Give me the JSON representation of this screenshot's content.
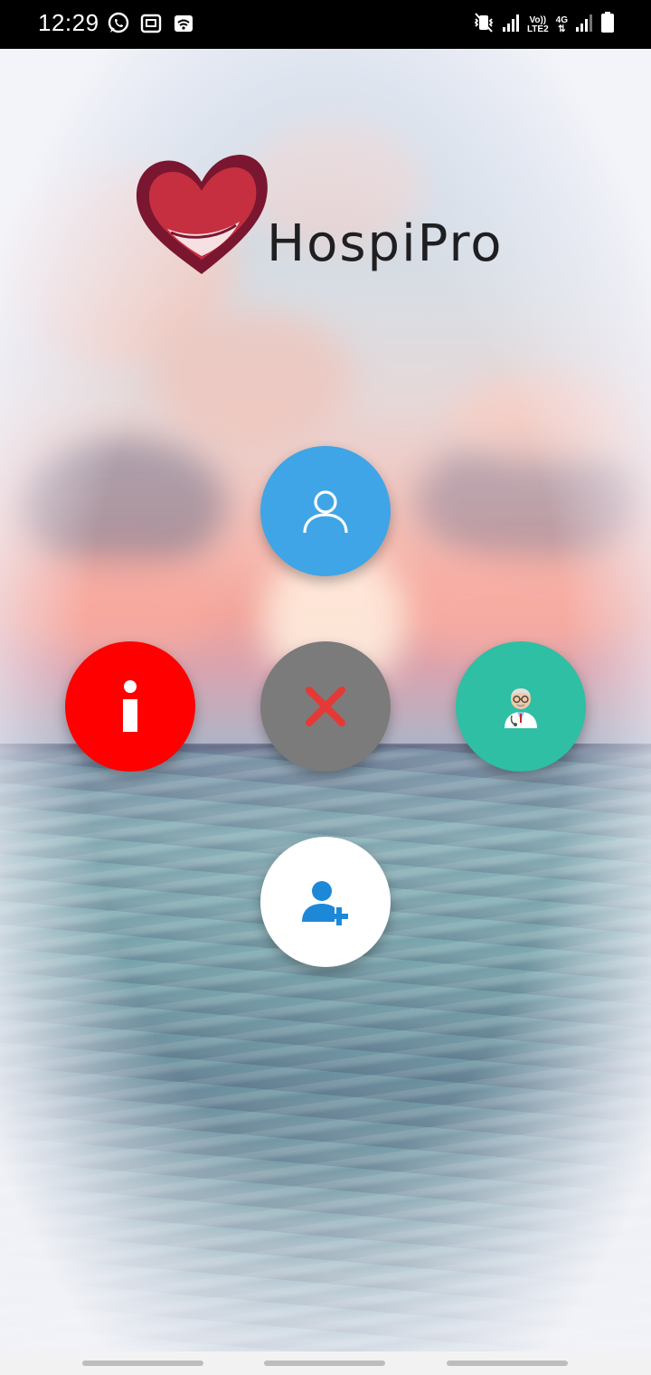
{
  "status_bar": {
    "time": "12:29",
    "left_icons": [
      "whatsapp-icon",
      "app-icon",
      "wifi-calling-icon"
    ],
    "network_top": "Vo))",
    "network_bottom": "LTE2",
    "data_type": "4G"
  },
  "logo": {
    "brand_name": "HospiPro",
    "colors": {
      "heart": "#c62f3f",
      "heart_dark": "#7a1630"
    }
  },
  "fab_menu": {
    "profile": {
      "icon": "user-outline-icon",
      "color": "#3fa5e6"
    },
    "info": {
      "icon": "info-icon",
      "color": "#ff0000"
    },
    "close": {
      "icon": "close-x-icon",
      "color": "#7b7b7b",
      "icon_color": "#e53935"
    },
    "doctor": {
      "icon": "doctor-icon",
      "color": "#2fbfa4"
    },
    "add_patient": {
      "icon": "add-user-icon",
      "color": "#ffffff",
      "icon_color": "#1e88d8"
    }
  },
  "nav_bar": {
    "buttons": [
      "recent-apps",
      "home",
      "back"
    ]
  }
}
